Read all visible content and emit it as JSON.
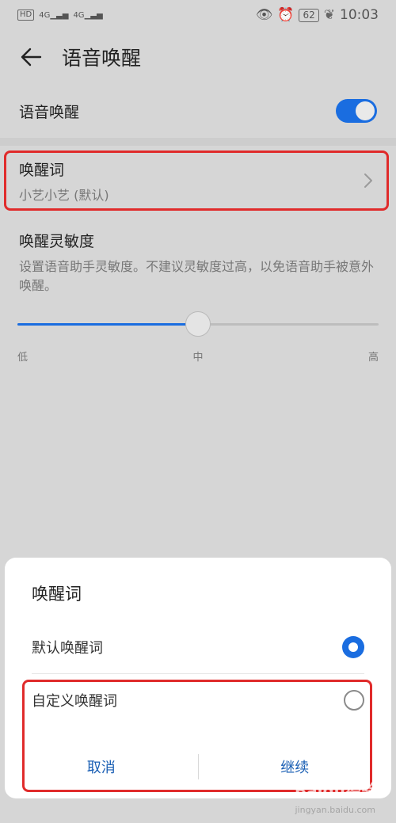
{
  "statusbar": {
    "hd": "HD",
    "signal1": "4G",
    "signal2": "4G",
    "battery": "62",
    "time": "10:03"
  },
  "header": {
    "title": "语音唤醒"
  },
  "voice_wake": {
    "label": "语音唤醒",
    "enabled": true
  },
  "wake_word": {
    "title": "唤醒词",
    "value": "小艺小艺 (默认)"
  },
  "sensitivity": {
    "title": "唤醒灵敏度",
    "description": "设置语音助手灵敏度。不建议灵敏度过高，以免语音助手被意外唤醒。",
    "level": 0.5,
    "ticks": {
      "low": "低",
      "mid": "中",
      "high": "高"
    }
  },
  "dialog": {
    "title": "唤醒词",
    "options": [
      {
        "label": "默认唤醒词",
        "selected": true
      },
      {
        "label": "自定义唤醒词",
        "selected": false
      }
    ],
    "cancel_label": "取消",
    "continue_label": "继续"
  },
  "watermark": {
    "brand": "Baidu经验",
    "url": "jingyan.baidu.com"
  },
  "colors": {
    "accent": "#1a6de0",
    "highlight": "#e02b2b",
    "button_text": "#1a5fb4"
  }
}
